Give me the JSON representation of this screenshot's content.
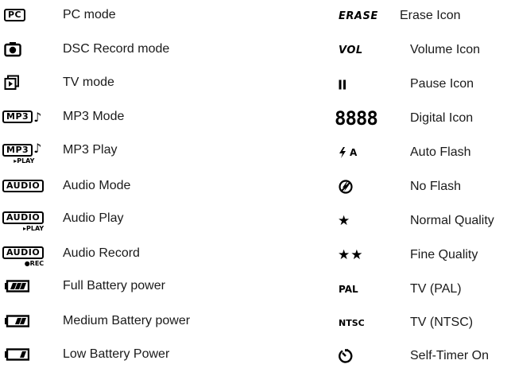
{
  "left": {
    "items": [
      {
        "icon_name": "pc-mode-icon",
        "icon_text": "PC",
        "label": "PC mode"
      },
      {
        "icon_name": "camera-icon",
        "label": "DSC Record mode"
      },
      {
        "icon_name": "tv-mode-icon",
        "label": "TV mode"
      },
      {
        "icon_name": "mp3-mode-icon",
        "icon_text": "MP3",
        "icon_glyph": "♪",
        "label": "MP3 Mode"
      },
      {
        "icon_name": "mp3-play-icon",
        "icon_text": "MP3",
        "icon_glyph": "♪",
        "icon_sub": "▸PLAY",
        "label": "MP3 Play"
      },
      {
        "icon_name": "audio-mode-icon",
        "icon_text": "AUDIO",
        "label": "Audio Mode"
      },
      {
        "icon_name": "audio-play-icon",
        "icon_text": "AUDIO",
        "icon_sub": "▸PLAY",
        "label": "Audio Play"
      },
      {
        "icon_name": "audio-record-icon",
        "icon_text": "AUDIO",
        "icon_sub": "●REC",
        "label": "Audio Record"
      },
      {
        "icon_name": "battery-full-icon",
        "battery_level": 1.0,
        "label": "Full Battery power"
      },
      {
        "icon_name": "battery-medium-icon",
        "battery_level": 0.67,
        "label": "Medium Battery power"
      },
      {
        "icon_name": "battery-low-icon",
        "battery_level": 0.33,
        "label": "Low Battery Power"
      }
    ]
  },
  "right": {
    "items": [
      {
        "icon_name": "erase-icon",
        "icon_text": "ERASE",
        "label": "Erase Icon"
      },
      {
        "icon_name": "volume-icon",
        "icon_text": "VOL",
        "label": "Volume Icon"
      },
      {
        "icon_name": "pause-icon",
        "icon_text": "II",
        "label": "Pause Icon"
      },
      {
        "icon_name": "digital-icon",
        "icon_text": "8888",
        "label": "Digital Icon"
      },
      {
        "icon_name": "auto-flash-icon",
        "icon_text": "A",
        "label": "Auto Flash"
      },
      {
        "icon_name": "no-flash-icon",
        "label": "No Flash"
      },
      {
        "icon_name": "normal-quality-icon",
        "icon_text": "★",
        "label": "Normal Quality"
      },
      {
        "icon_name": "fine-quality-icon",
        "icon_text": "★★",
        "label": "Fine Quality"
      },
      {
        "icon_name": "pal-icon",
        "icon_text": "PAL",
        "label": "TV (PAL)"
      },
      {
        "icon_name": "ntsc-icon",
        "icon_text": "NTSC",
        "label": "TV (NTSC)"
      },
      {
        "icon_name": "self-timer-icon",
        "label": "Self-Timer On"
      }
    ]
  }
}
